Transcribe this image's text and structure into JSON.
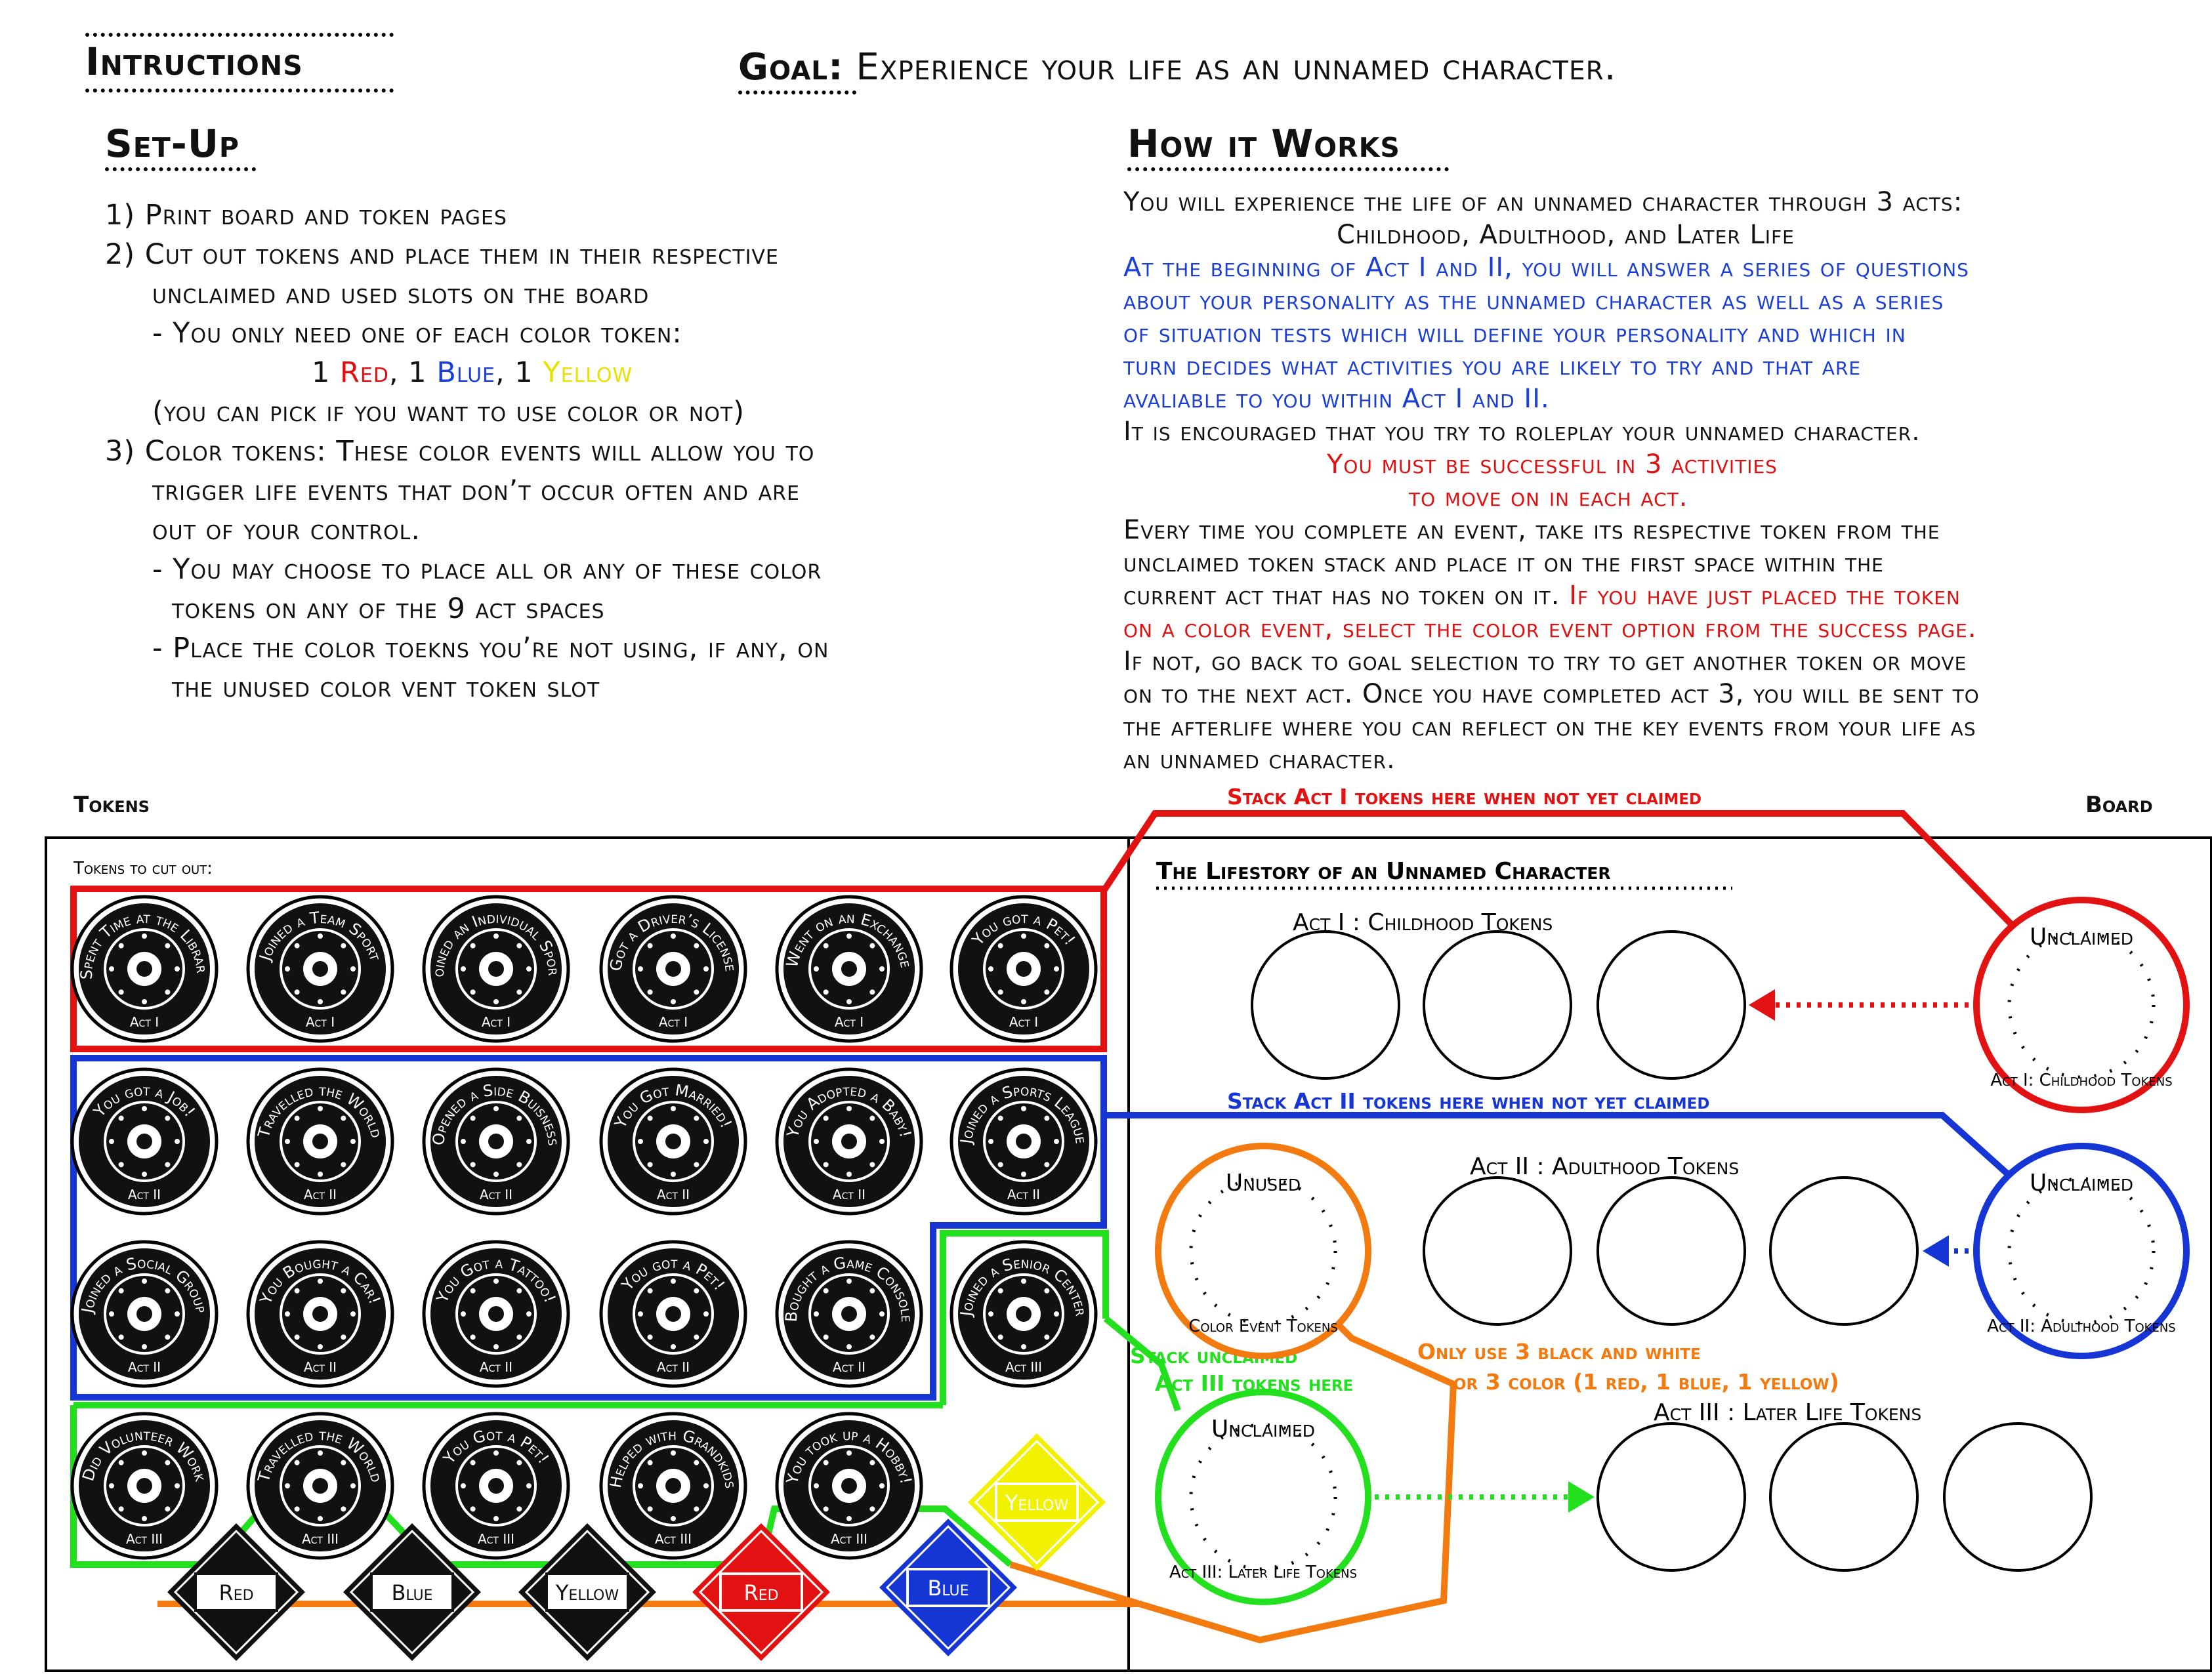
{
  "header": {
    "instructions_title": "Intructions",
    "goal_label": "Goal:",
    "goal_text": "Experience your life as an unnamed character."
  },
  "setup": {
    "title": "Set-Up",
    "lines": [
      "1) Print board and token pages",
      "2) Cut out tokens and place them in their respective",
      "unclaimed and used slots on the board",
      "- You only need one of each color token:",
      "(you can pick if you want to use color or not)",
      "3) Color tokens: These color events will allow you to",
      "trigger life events that don’t occur often and are",
      "out of your control.",
      "- You may choose to place all or any of these color",
      "tokens on any of the 9 act spaces",
      "- Place the color toekns you’re not using, if any, on",
      "the unused color vent token slot"
    ],
    "color_line": {
      "n1": "1",
      "red": "Red",
      "sep1": ", 1",
      "blue": "Blue",
      "sep2": ", 1",
      "yellow": "Yellow"
    }
  },
  "how": {
    "title": "How it Works",
    "p1a": "You will experience the life of an unnamed character through 3 acts:",
    "p1b": "Childhood, Adulthood, and Later Life",
    "blue_lines": [
      "At the beginning of Act I and II, you will answer a series of questions",
      "about your personality as the unnamed character as well as a series",
      "of situation tests which will define your personality and which in",
      "turn decides what activities you are likely to try and that are",
      "avaliable to you within Act I and II."
    ],
    "encourage": "It is encouraged that you try to roleplay your unnamed character.",
    "must1": "You must be successful in 3 activities",
    "must2": "to move on in each act.",
    "every1": "Every time you complete an event, take its respective token from the",
    "every2": "unclaimed token stack and place it on the first space within the",
    "every3a": "current act that has no token on it. ",
    "every3b": "If you have just placed the token",
    "every4": "on a color event, select the color event option from the success page.",
    "every5": "If not, go back to goal selection to try to get another token or move",
    "every6": "on to the next act. Once you have completed act 3, you will be sent to",
    "every7": "the afterlife where you can reflect on the key events from your life as",
    "every8": "an unnamed character."
  },
  "labels": {
    "tokens": "Tokens",
    "board": "Board",
    "tokens_to_cut": "Tokens to cut out:",
    "stack_act1": "Stack Act I tokens here when not yet claimed",
    "stack_act2": "Stack Act II tokens here when not yet claimed",
    "stack_act3a": "Stack unclaimed",
    "stack_act3b": "Act III tokens here",
    "only_use1": "Only use 3 black and white",
    "only_use2": "or 3 color (1 red, 1 blue, 1 yellow)"
  },
  "board": {
    "title": "The Lifestory of an Unnamed Character",
    "act1": "Act I : Childhood Tokens",
    "act2": "Act II : Adulthood Tokens",
    "act3": "Act III : Later Life Tokens",
    "unclaimed": "Unclaimed",
    "unclaimed_act1": "Act I: Childhood Tokens",
    "unclaimed_act2": "Act II: Adulthood Tokens",
    "unclaimed_act3": "Act III: Later Life Tokens",
    "unused": "Unused",
    "unused_sub": "Color Event Tokens"
  },
  "tokens": {
    "act1": [
      {
        "text": "Spent Time at the Library",
        "act": "Act I",
        "icon": "book-icon"
      },
      {
        "text": "Joined a Team Sport",
        "act": "Act I",
        "icon": "team-icon"
      },
      {
        "text": "Joined an Individual Sport",
        "act": "Act I",
        "icon": "athlete-icon"
      },
      {
        "text": "Got a Driver’s License",
        "act": "Act I",
        "icon": "license-icon"
      },
      {
        "text": "Went on an Exchange",
        "act": "Act I",
        "icon": "plane-icon"
      },
      {
        "text": "You got a Pet!",
        "act": "Act I",
        "icon": "cat-icon"
      }
    ],
    "act2_row1": [
      {
        "text": "You got a Job!",
        "act": "Act II",
        "icon": "worker-icon"
      },
      {
        "text": "Travelled the World",
        "act": "Act II",
        "icon": "plane-icon"
      },
      {
        "text": "Opened a Side Buisness",
        "act": "Act II",
        "icon": "tools-icon"
      },
      {
        "text": "You Got Married!",
        "act": "Act II",
        "icon": "couple-icon"
      },
      {
        "text": "You Adopted a Baby!",
        "act": "Act II",
        "icon": "baby-icon"
      },
      {
        "text": "Joined a Sports League",
        "act": "Act II",
        "icon": "team-icon"
      }
    ],
    "act2_row2": [
      {
        "text": "Joined a Social Group",
        "act": "Act II",
        "icon": "group-icon"
      },
      {
        "text": "You Bought a Car!",
        "act": "Act II",
        "icon": "car-icon"
      },
      {
        "text": "You Got a Tattoo!",
        "act": "Act II",
        "icon": "heart-icon"
      },
      {
        "text": "You got a Pet!",
        "act": "Act II",
        "icon": "lion-icon"
      },
      {
        "text": "Bought a Game Console",
        "act": "Act II",
        "icon": "console-icon"
      }
    ],
    "act3": [
      {
        "text": "Did Volunteer Work",
        "act": "Act III",
        "icon": "hands-icon"
      },
      {
        "text": "Travelled the World",
        "act": "Act III",
        "icon": "plane-icon"
      },
      {
        "text": "You Got a Pet!",
        "act": "Act III",
        "icon": "dog-icon"
      },
      {
        "text": "Helped with Grandkids",
        "act": "Act III",
        "icon": "baby-icon"
      },
      {
        "text": "You took up a Hobby!",
        "act": "Act III",
        "icon": "paperplane-icon"
      }
    ],
    "senior": {
      "text": "Joined a Senior Center",
      "act": "Act III",
      "icon": "group-icon"
    },
    "color_bw": [
      "Red",
      "Blue",
      "Yellow"
    ],
    "color_col": [
      "Red",
      "Blue",
      "Yellow"
    ]
  },
  "colors": {
    "red": "#e31212",
    "blue": "#1535d4",
    "green": "#22e01e",
    "orange": "#f27a0f",
    "yellow": "#f2f200"
  }
}
